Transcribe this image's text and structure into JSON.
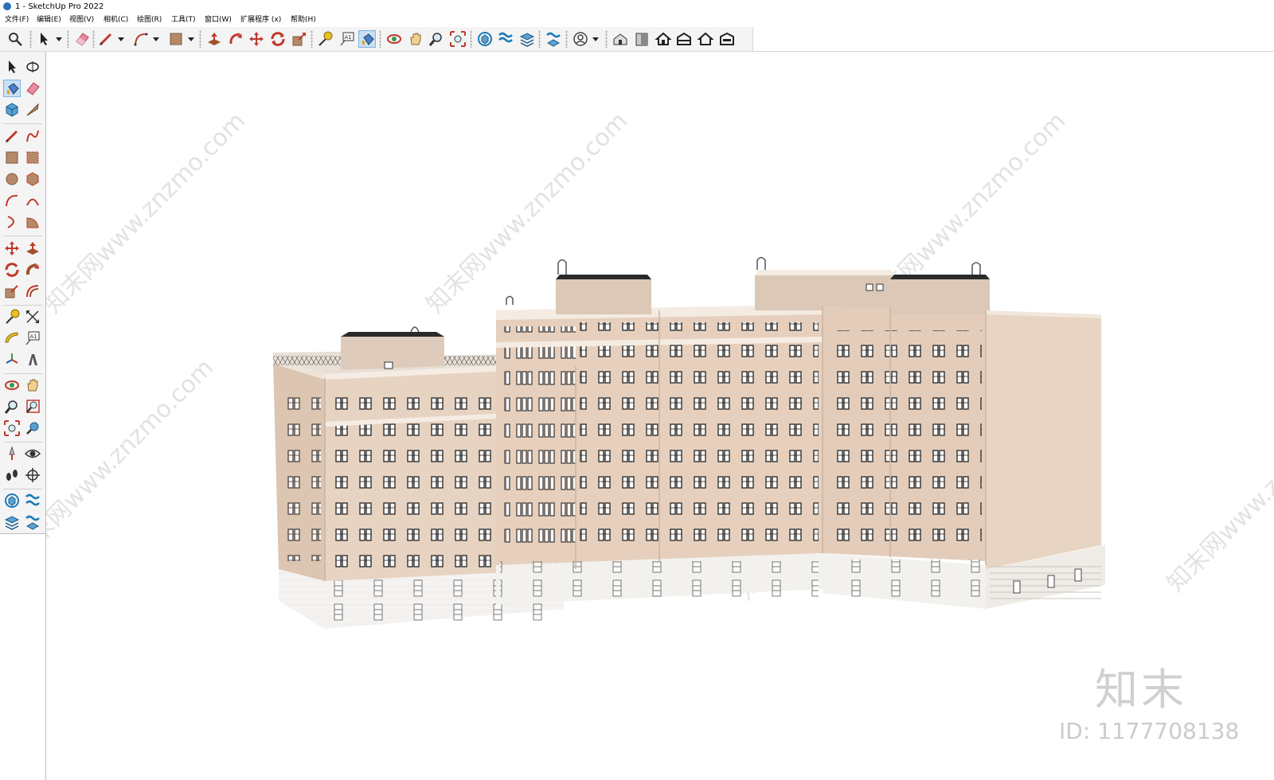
{
  "window": {
    "title": "1 - SketchUp Pro 2022"
  },
  "menubar": {
    "items": [
      "文件(F)",
      "编辑(E)",
      "视图(V)",
      "相机(C)",
      "绘图(R)",
      "工具(T)",
      "窗口(W)",
      "扩展程序 (x)",
      "帮助(H)"
    ]
  },
  "toolbar": {
    "icons": [
      "search-icon",
      "select-icon",
      "eraser-icon",
      "pencil-icon",
      "arc-icon",
      "rectangle-icon",
      "pushpull-icon",
      "followme-icon",
      "move-icon",
      "rotate-icon",
      "scale-icon",
      "tape-measure-icon",
      "text-icon",
      "paint-bucket-icon",
      "orbit-icon",
      "pan-icon",
      "zoom-icon",
      "zoom-extents-icon",
      "components-icon",
      "sandbox-icon",
      "layers-icon",
      "styles-icon",
      "profile-icon",
      "warehouse-icon",
      "extension-icon",
      "house-icon",
      "house-outline-icon",
      "house-share-icon"
    ],
    "text_tool_glyph": "A1"
  },
  "left_toolbar": {
    "icons": [
      "select-icon",
      "orbit-icon",
      "paint-bucket-icon",
      "eraser-icon",
      "components-icon",
      "tape-icon",
      "pencil-icon",
      "freehand-icon",
      "rectangle-icon",
      "rotated-rectangle-icon",
      "circle-icon",
      "polygon-icon",
      "arc-icon",
      "two-point-arc-icon",
      "three-point-arc-icon",
      "pie-icon",
      "move-icon",
      "pushpull-icon",
      "rotate-icon",
      "followme-icon",
      "scale-icon",
      "offset-icon",
      "tape-measure-icon",
      "dimension-icon",
      "protractor-icon",
      "text-icon",
      "axes-icon",
      "3d-text-icon",
      "orbit-icon",
      "pan-icon",
      "zoom-icon",
      "zoom-window-icon",
      "zoom-extents-icon",
      "previous-view-icon",
      "position-camera-icon",
      "look-around-icon",
      "walk-icon",
      "section-plane-icon",
      "components-panel-icon",
      "sandbox-icon",
      "layers-icon",
      "styles-icon"
    ],
    "text_tool_glyph": "A1"
  },
  "watermark": {
    "brand": "知末",
    "id_text": "ID: 1177708138",
    "diagonal_text": "知末网www.znzmo.com"
  },
  "colors": {
    "toolbar_bg": "#f4f4f4",
    "active_tool": "#c9e0f5",
    "facade": "#e6d0bd",
    "base": "#f3f1ee",
    "roof": "#dfcbbb"
  }
}
